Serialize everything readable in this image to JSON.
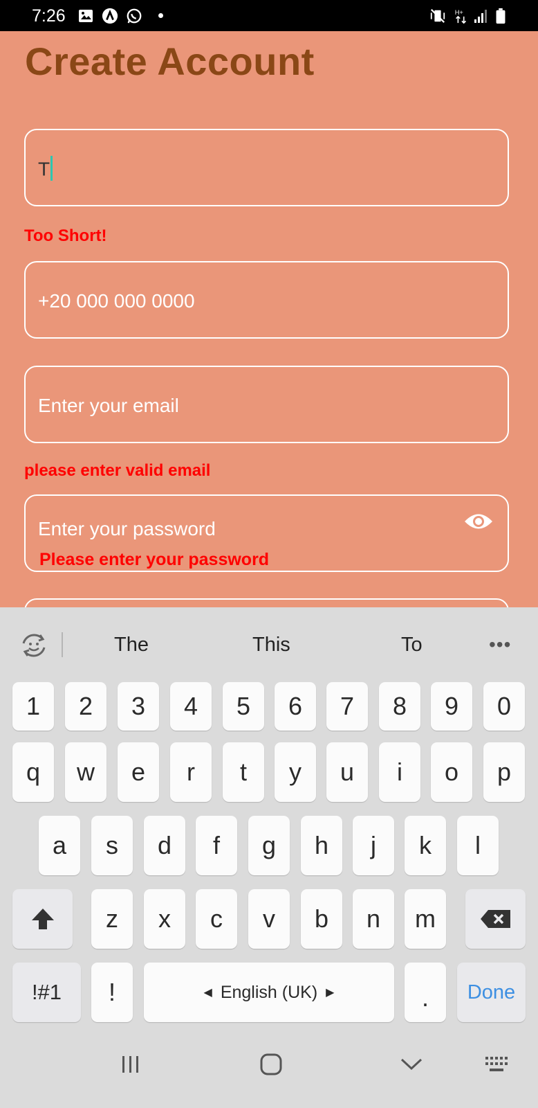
{
  "status_bar": {
    "time": "7:26",
    "left_icons": [
      "image-icon",
      "app-a-icon",
      "whatsapp-icon",
      "dot-icon"
    ],
    "right_icons": [
      "vibrate-mute-icon",
      "data-arrows-icon",
      "signal-icon",
      "battery-icon"
    ]
  },
  "form": {
    "title": "Create Account",
    "name_field": {
      "value": "T",
      "error": "Too Short!"
    },
    "phone_field": {
      "placeholder": "+20 000 000 0000"
    },
    "email_field": {
      "placeholder": "Enter your email",
      "error": "please enter valid email"
    },
    "password_field": {
      "placeholder": "Enter your password",
      "error": "Please enter your password",
      "icon": "eye-icon"
    }
  },
  "keyboard": {
    "suggestions": [
      "The",
      "This",
      "To"
    ],
    "number_row": [
      "1",
      "2",
      "3",
      "4",
      "5",
      "6",
      "7",
      "8",
      "9",
      "0"
    ],
    "row1": [
      "q",
      "w",
      "e",
      "r",
      "t",
      "y",
      "u",
      "i",
      "o",
      "p"
    ],
    "row2": [
      "a",
      "s",
      "d",
      "f",
      "g",
      "h",
      "j",
      "k",
      "l"
    ],
    "row3": [
      "z",
      "x",
      "c",
      "v",
      "b",
      "n",
      "m"
    ],
    "bottom": {
      "symbols": "!#1",
      "exclaim": "!",
      "space": "English (UK)",
      "period": ".",
      "done": "Done"
    }
  },
  "colors": {
    "background": "#ea9679",
    "title": "#8a4716",
    "error": "#ff0000",
    "done": "#3d8fe2"
  }
}
